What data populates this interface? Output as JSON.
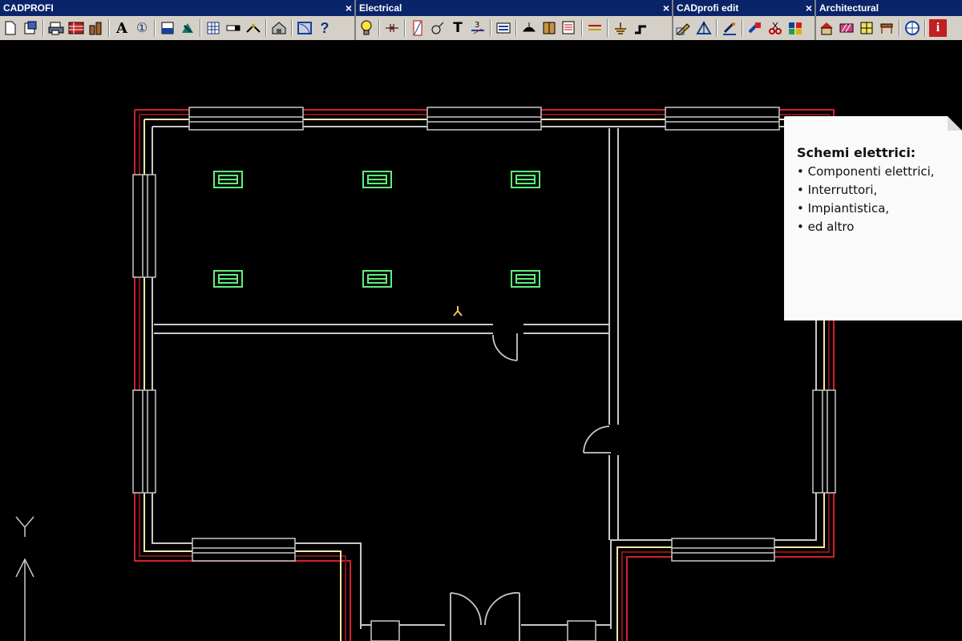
{
  "toolbars": {
    "cadprofi": {
      "title": "CADPROFI",
      "close": "×"
    },
    "electrical": {
      "title": "Electrical",
      "close": "×"
    },
    "cadprofi_edit": {
      "title": "CADprofi edit",
      "close": "×"
    },
    "architectural": {
      "title": "Architectural",
      "close": "×"
    }
  },
  "icons": {
    "text_a": "A",
    "circle_one": "①",
    "help": "?",
    "text_t": "T",
    "number_3": "3",
    "info": "i"
  },
  "note": {
    "title": "Schemi elettrici:",
    "items": [
      "Componenti elettrici,",
      "Interruttori,",
      "Impiantistica,",
      "ed altro"
    ]
  },
  "ucs": {
    "y_label": "Y"
  },
  "colors": {
    "canvas": "#000000",
    "wall_red": "#d0202f",
    "wall_yellow": "#f3e9a6",
    "wall_gray": "#c8c8c8",
    "fixture_green": "#5ef07a",
    "cursor_yellow": "#f0c060",
    "toolbar_title": "#0a246a",
    "toolbar_bg": "#d4d0c8"
  }
}
